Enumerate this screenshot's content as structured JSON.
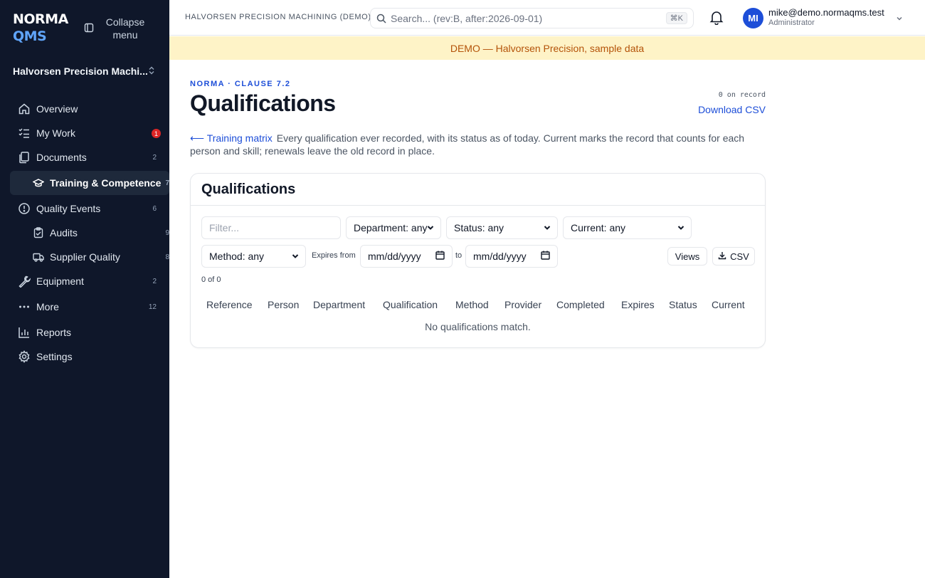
{
  "brand": {
    "line1": "NORMA",
    "line2": "QMS"
  },
  "sidebar": {
    "collapse_label": "Collapse menu",
    "org_name": "Halvorsen Precision Machi...",
    "items": [
      {
        "label": "Overview",
        "icon": "home-icon"
      },
      {
        "label": "My Work",
        "icon": "checklist-icon",
        "badge": "1"
      },
      {
        "label": "Documents",
        "icon": "documents-icon",
        "count": "2"
      },
      {
        "label": "Training & Competence",
        "icon": "graduation-cap-icon",
        "count": "7",
        "active": true
      },
      {
        "label": "Quality Events",
        "icon": "alert-circle-icon",
        "count": "6"
      },
      {
        "label": "Audits",
        "icon": "clipboard-icon",
        "count": "9"
      },
      {
        "label": "Supplier Quality",
        "icon": "truck-icon",
        "count": "8"
      },
      {
        "label": "Equipment",
        "icon": "wrench-icon",
        "count": "2"
      },
      {
        "label": "More",
        "icon": "more-icon",
        "count": "12"
      },
      {
        "label": "Reports",
        "icon": "bar-chart-icon"
      },
      {
        "label": "Settings",
        "icon": "gear-icon"
      }
    ]
  },
  "topbar": {
    "org_caps": "HALVORSEN PRECISION MACHINING (DEMO)",
    "search_placeholder": "Search... (rev:B, after:2026-09-01)",
    "shortcut": "⌘K",
    "avatar_initials": "MI",
    "user_email": "mike@demo.normaqms.test",
    "user_role": "Administrator"
  },
  "banner": "DEMO — Halvorsen Precision, sample data",
  "page": {
    "eyebrow": "NORMA · CLAUSE 7.2",
    "title": "Qualifications",
    "record_count": "0 on record",
    "download_label": "Download CSV",
    "back_link": "⟵ Training matrix",
    "description": "Every qualification ever recorded, with its status as of today. Current marks the record that counts for each person and skill; renewals leave the old record in place."
  },
  "card": {
    "title": "Qualifications",
    "filter_placeholder": "Filter...",
    "department": "Department: any",
    "status": "Status: any",
    "current": "Current: any",
    "method": "Method: any",
    "expires_from_label": "Expires from",
    "to_label": "to",
    "date_placeholder": "mm/dd/yyyy",
    "views_label": "Views",
    "csv_label": "CSV",
    "count_text": "0 of 0",
    "columns": [
      "Reference",
      "Person",
      "Department",
      "Qualification",
      "Method",
      "Provider",
      "Completed",
      "Expires",
      "Status",
      "Current"
    ],
    "empty_message": "No qualifications match."
  }
}
